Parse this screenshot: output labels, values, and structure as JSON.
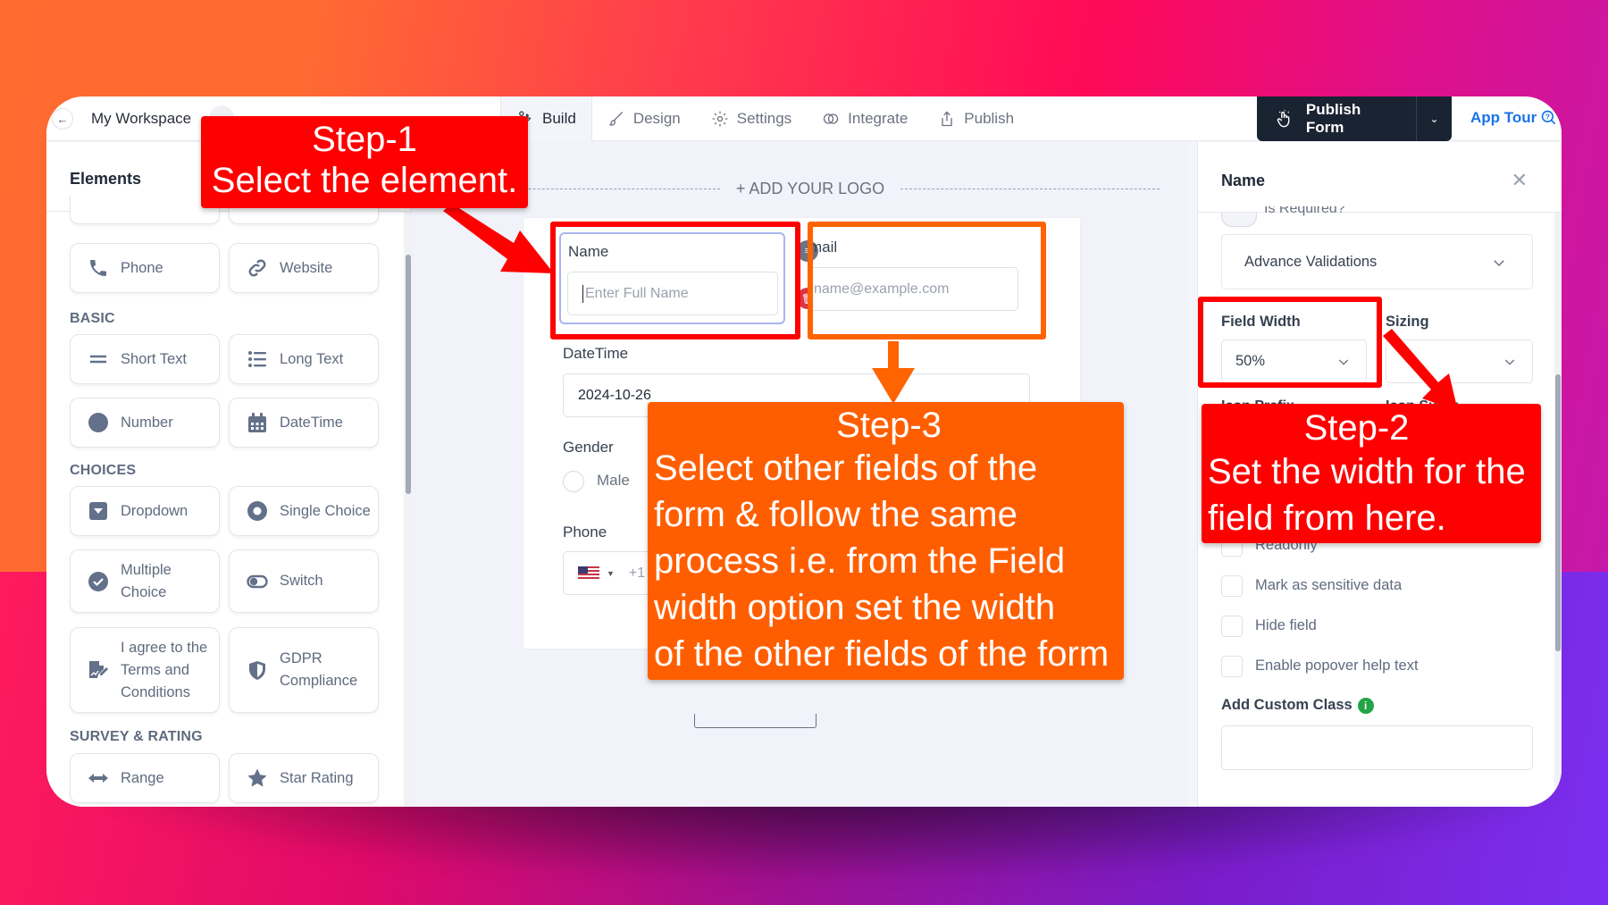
{
  "topbar": {
    "back_icon": "arrow-left-icon",
    "breadcrumb": [
      "My Workspace"
    ],
    "tabs": [
      {
        "label": "Build",
        "icon": "wrench-icon",
        "active": true
      },
      {
        "label": "Design",
        "icon": "brush-icon",
        "active": false
      },
      {
        "label": "Settings",
        "icon": "gear-icon",
        "active": false
      },
      {
        "label": "Integrate",
        "icon": "link-rings-icon",
        "active": false
      },
      {
        "label": "Publish",
        "icon": "share-upload-icon",
        "active": false
      }
    ],
    "publish_button": "Publish Form",
    "publish_icon": "hand-pointer-icon",
    "app_tour": "App Tour",
    "app_tour_icon": "help-search-icon"
  },
  "sidebar": {
    "title": "Elements",
    "top_row": [
      {
        "label": "Phone",
        "icon": "phone-icon"
      },
      {
        "label": "Website",
        "icon": "link-icon"
      }
    ],
    "sections": [
      {
        "title": "BASIC",
        "items": [
          {
            "label": "Short Text",
            "icon": "short-text-icon"
          },
          {
            "label": "Long Text",
            "icon": "list-icon"
          },
          {
            "label": "Number",
            "icon": "circle-icon"
          },
          {
            "label": "DateTime",
            "icon": "calendar-icon"
          }
        ]
      },
      {
        "title": "CHOICES",
        "items": [
          {
            "label": "Dropdown",
            "icon": "dropdown-icon"
          },
          {
            "label": "Single Choice",
            "icon": "radio-icon"
          },
          {
            "label": "Multiple Choice",
            "icon": "check-circle-icon"
          },
          {
            "label": "Switch",
            "icon": "toggle-icon"
          },
          {
            "label": "I agree to the Terms and Conditions",
            "icon": "signature-icon"
          },
          {
            "label": "GDPR Compliance",
            "icon": "shield-icon"
          }
        ]
      },
      {
        "title": "SURVEY & RATING",
        "items": [
          {
            "label": "Range",
            "icon": "arrows-horizontal-icon"
          },
          {
            "label": "Star Rating",
            "icon": "star-icon"
          }
        ]
      }
    ]
  },
  "canvas": {
    "add_logo": "+ ADD YOUR LOGO",
    "fields": {
      "name": {
        "label": "Name",
        "placeholder": "Enter Full Name"
      },
      "email": {
        "label": "mail",
        "placeholder": "name@example.com"
      },
      "datetime": {
        "label": "DateTime",
        "value": "2024-10-26"
      },
      "gender": {
        "label": "Gender",
        "option": "Male"
      },
      "phone": {
        "label": "Phone",
        "country_code": "+1",
        "flag": "us-flag-icon"
      }
    }
  },
  "panel": {
    "title": "Name",
    "close_icon": "close-icon",
    "is_required_label": "Is Required?",
    "advance_validations": "Advance Validations",
    "field_width_label": "Field Width",
    "field_width_value": "50%",
    "sizing_label": "Sizing",
    "sizing_value": "",
    "icon_prefix_label": "Icon Prefix",
    "icon_suffix_label": "Icon Suffix",
    "checkboxes": [
      {
        "label": "Readonly",
        "checked": false
      },
      {
        "label": "Mark as sensitive data",
        "checked": false
      },
      {
        "label": "Hide field",
        "checked": false
      },
      {
        "label": "Enable popover help text",
        "checked": false
      }
    ],
    "custom_class_label": "Add Custom Class",
    "custom_class_value": "",
    "info_color": "#22a447"
  },
  "annotations": {
    "step1": {
      "title": "Step-1",
      "text": "Select the element.",
      "color": "#ff0000"
    },
    "step2": {
      "title": "Step-2",
      "text_lines": [
        "Set the width for the",
        "field from here."
      ],
      "color": "#ff0000"
    },
    "step3": {
      "title": "Step-3",
      "text_lines": [
        "Select other fields of the",
        "form & follow the same",
        "process i.e. from the Field",
        "width option set the width",
        "of the other fields of the form"
      ],
      "color": "#ff5e00"
    }
  }
}
